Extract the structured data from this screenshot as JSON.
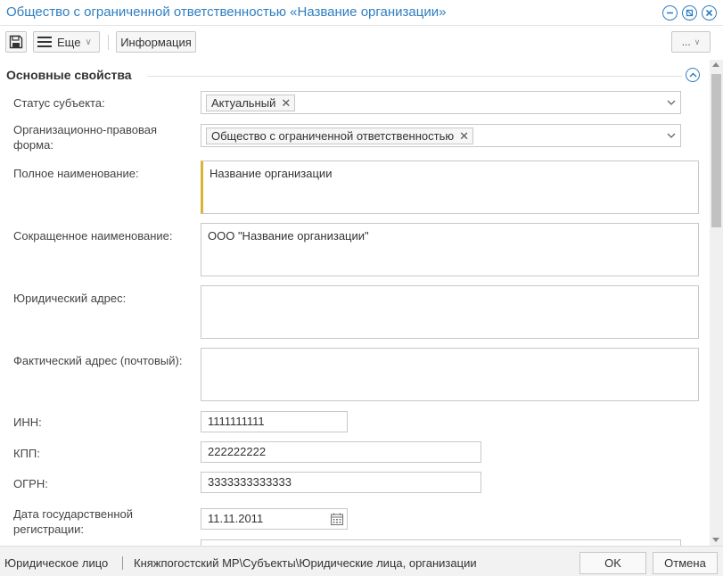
{
  "window": {
    "title": "Общество с ограниченной ответственностью «Название организации»"
  },
  "toolbar": {
    "more_label": "Еще",
    "info_label": "Информация",
    "dots_label": "..."
  },
  "section": {
    "title": "Основные свойства"
  },
  "fields": {
    "status": {
      "label": "Статус субъекта:",
      "value": "Актуальный"
    },
    "legal_form": {
      "label_line1": "Организационно-правовая",
      "label_line2": "форма:",
      "value": "Общество с ограниченной ответственностью"
    },
    "full_name": {
      "label": "Полное наименование:",
      "value": "Название организации"
    },
    "short_name": {
      "label": "Сокращенное наименование:",
      "value": "ООО \"Название организации\""
    },
    "legal_address": {
      "label": "Юридический адрес:",
      "value": ""
    },
    "actual_address": {
      "label": "Фактический адрес (почтовый):",
      "value": ""
    },
    "inn": {
      "label": "ИНН:",
      "value": "1111111111"
    },
    "kpp": {
      "label": "КПП:",
      "value": "222222222"
    },
    "ogrn": {
      "label": "ОГРН:",
      "value": "3333333333333"
    },
    "reg_date": {
      "label_line1": "Дата государственной",
      "label_line2": "регистрации:",
      "value": "11.11.2011"
    }
  },
  "statusbar": {
    "type": "Юридическое лицо",
    "path": "Княжпогостский МР\\Субъекты\\Юридические лица, организации"
  },
  "buttons": {
    "ok": "OK",
    "cancel": "Отмена"
  },
  "colors": {
    "accent": "#2f7ec0",
    "required_marker": "#d9b43a"
  },
  "icons": {
    "save": "floppy-disk-icon",
    "more": "hamburger-menu-icon",
    "calendar": "calendar-icon"
  }
}
